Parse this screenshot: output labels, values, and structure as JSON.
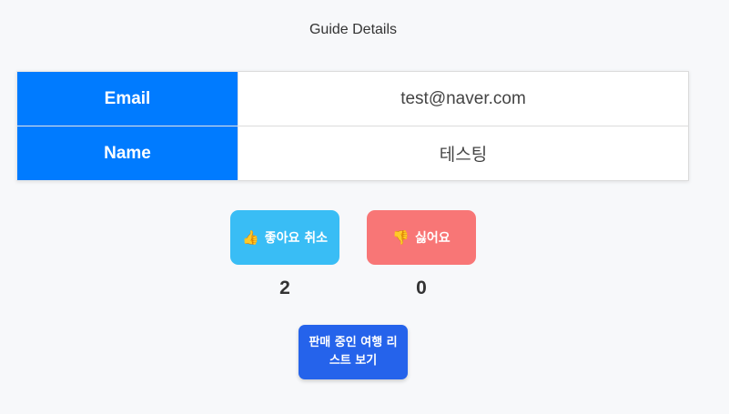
{
  "page": {
    "title": "Guide Details"
  },
  "guide": {
    "email_label": "Email",
    "email_value": "test@naver.com",
    "name_label": "Name",
    "name_value": "테스팅"
  },
  "votes": {
    "like_label": "좋아요 취소",
    "like_icon": "thumbs-up-icon",
    "like_count": "2",
    "dislike_label": "싫어요",
    "dislike_icon": "thumbs-down-icon",
    "dislike_count": "0"
  },
  "actions": {
    "view_list_label": "판매 중인 여행 리스트 보기"
  },
  "colors": {
    "header_cell": "#007bff",
    "like_button": "#39bdf5",
    "dislike_button": "#f87676",
    "list_button": "#2563eb"
  }
}
